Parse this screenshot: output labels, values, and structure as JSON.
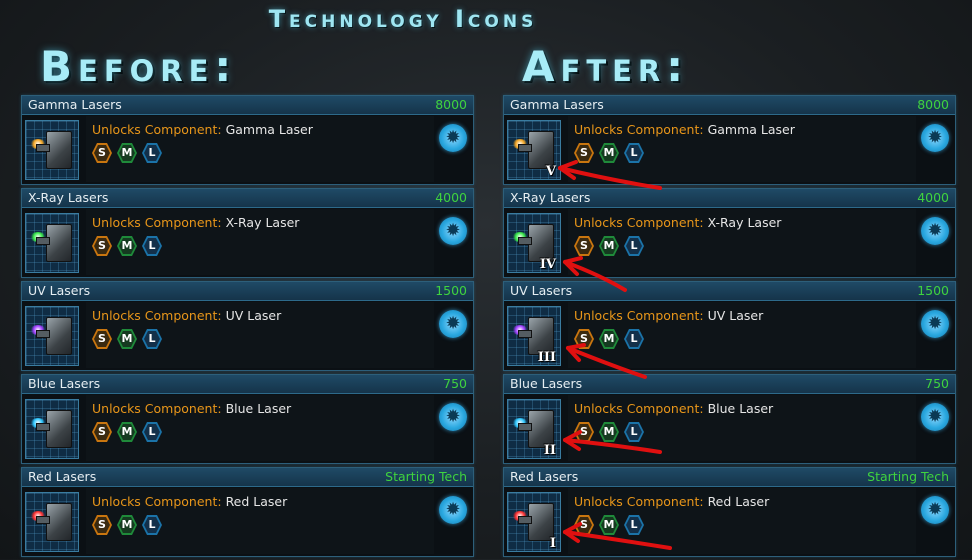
{
  "page": {
    "title": "Technology Icons",
    "before_heading": "Before:",
    "after_heading": "After:"
  },
  "badges": {
    "small": "S",
    "medium": "M",
    "large": "L"
  },
  "unlock_label": "Unlocks Component:",
  "techs": [
    {
      "name": "Gamma Lasers",
      "cost": "8000",
      "component": "Gamma Laser",
      "rank": "V",
      "glow": "#f5a623"
    },
    {
      "name": "X-Ray Lasers",
      "cost": "4000",
      "component": "X-Ray Laser",
      "rank": "IV",
      "glow": "#39e84a"
    },
    {
      "name": "UV Lasers",
      "cost": "1500",
      "component": "UV Laser",
      "rank": "III",
      "glow": "#a040ff"
    },
    {
      "name": "Blue Lasers",
      "cost": "750",
      "component": "Blue Laser",
      "rank": "II",
      "glow": "#30c8ff"
    },
    {
      "name": "Red Lasers",
      "cost": "Starting Tech",
      "component": "Red Laser",
      "rank": "I",
      "glow": "#ff3030"
    }
  ],
  "colors": {
    "cost": "#3fd33f",
    "unlock_label": "#e8961a",
    "heading": "#a8ecf7",
    "arrow": "#e01010"
  }
}
